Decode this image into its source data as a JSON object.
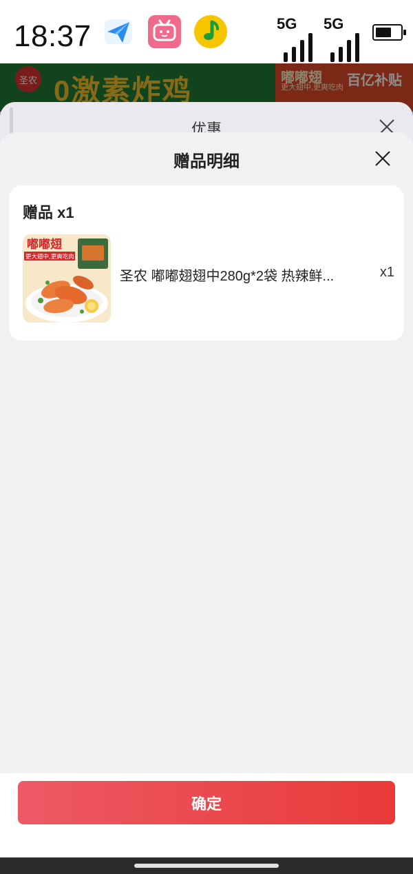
{
  "status_bar": {
    "time": "18:37",
    "signal_1": "5G",
    "signal_2": "5G",
    "icons": [
      "paper-plane-app-icon",
      "tv-app-icon",
      "music-app-icon",
      "battery-icon"
    ]
  },
  "background_page": {
    "badge": "圣农",
    "headline": "0激素炸鸡",
    "promo_title": "嘟嘟翅",
    "promo_sub": "更大翅中,更爽吃肉",
    "promo_badge": "百亿补贴",
    "sheet_title": "优惠"
  },
  "sheet": {
    "title": "赠品明细",
    "card": {
      "title": "赠品 x1",
      "items": [
        {
          "name": "圣农 嘟嘟翅翅中280g*2袋 热辣鲜...",
          "quantity": "x1",
          "image_banner": "嘟嘟翅",
          "image_slogan": "更大翅中,更爽吃肉"
        }
      ]
    },
    "confirm_label": "确定"
  },
  "colors": {
    "accent_start": "#ec5a66",
    "accent_end": "#e93a38",
    "sheet_bg": "#f1f1f3"
  }
}
